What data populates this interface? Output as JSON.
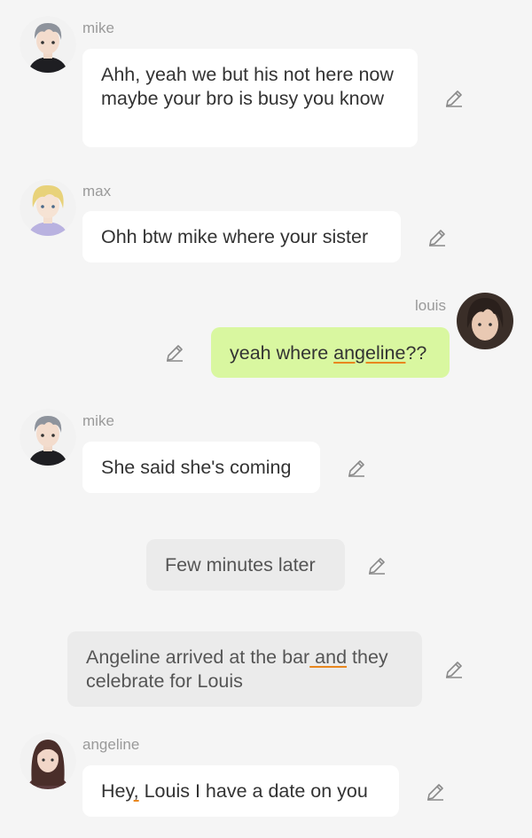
{
  "messages": [
    {
      "sender": "mike",
      "text": "Ahh, yeah we but his not here now maybe your bro is busy you know"
    },
    {
      "sender": "max",
      "text": "Ohh btw mike where your sister"
    },
    {
      "sender": "louis",
      "text_before": "yeah where ",
      "text_underlined": "angeline",
      "text_after": "??"
    },
    {
      "sender": "mike",
      "text": "She said she's coming"
    },
    {
      "narration": "Few minutes later"
    },
    {
      "narration_before": "Angeline arrived at the bar",
      "narration_underlined": " and",
      "narration_after": " they celebrate for Louis"
    },
    {
      "sender": "angeline",
      "text_before": "Hey",
      "text_underlined": ",",
      "text_after": " Louis I have a date on you"
    }
  ],
  "colors": {
    "background": "#f5f5f5",
    "own_bubble": "#d9f7a0",
    "other_bubble": "#ffffff",
    "narration_bubble": "#ebebeb",
    "spellcheck_underline": "#e8871e"
  },
  "icons": {
    "edit": "pencil-icon"
  }
}
